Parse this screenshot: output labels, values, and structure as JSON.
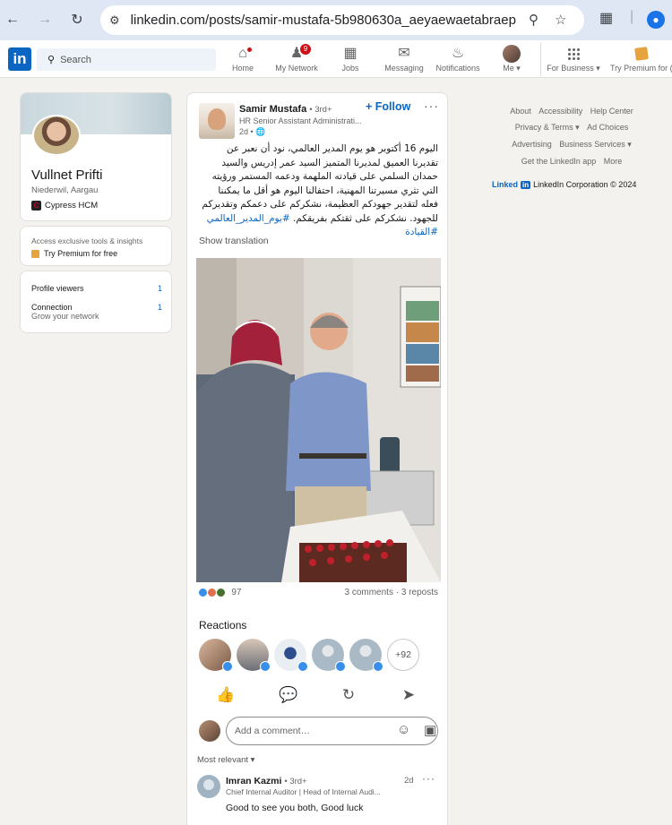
{
  "browser": {
    "url": "linkedin.com/posts/samir-mustafa-5b980630a_aeyaewaetabraepae...",
    "back_icon": "arrow-left",
    "forward_icon": "arrow-right",
    "reload_icon": "reload",
    "profile_initial": "•"
  },
  "header": {
    "search_placeholder": "Search",
    "nav": [
      {
        "label": "Home",
        "icon": "home-icon",
        "badge": ""
      },
      {
        "label": "My Network",
        "icon": "network-icon",
        "badge": "9"
      },
      {
        "label": "Jobs",
        "icon": "briefcase-icon",
        "badge": ""
      },
      {
        "label": "Messaging",
        "icon": "message-icon",
        "badge": ""
      },
      {
        "label": "Notifications",
        "icon": "bell-icon",
        "badge": ""
      },
      {
        "label": "Me",
        "icon": "avatar",
        "badge": ""
      },
      {
        "label": "For Business",
        "icon": "grid-icon",
        "badge": ""
      },
      {
        "label": "Try Premium for (",
        "icon": "premium-icon",
        "badge": ""
      }
    ]
  },
  "profile": {
    "name": "Vullnet Prifti",
    "location": "Niederwil, Aargau",
    "company": "Cypress HCM"
  },
  "premium": {
    "text": "Access exclusive tools & insights",
    "cta": "Try Premium for free"
  },
  "stats": {
    "profile_viewers_label": "Profile viewers",
    "profile_viewers_value": "1",
    "connection_label": "Connection",
    "connection_value": "1",
    "connection_sub": "Grow your network"
  },
  "footer": {
    "row1": [
      "About",
      "Accessibility",
      "Help Center"
    ],
    "row2": [
      "Privacy & Terms ▾",
      "Ad Choices"
    ],
    "row3": [
      "Advertising",
      "Business Services ▾"
    ],
    "row4": [
      "Get the LinkedIn app",
      "More"
    ],
    "brand_word": "Linked",
    "brand_box": "in",
    "copyright": "LinkedIn Corporation © 2024"
  },
  "post": {
    "author": "Samir Mustafa",
    "degree": "• 3rd+",
    "title": "HR Senior Assistant Administrati...",
    "time": "2d • 🌐",
    "follow": "+ Follow",
    "more": "···",
    "text_main": "اليوم 16 أكتوبر هو يوم المدير العالمي، نود أن نعبر عن تقديرنا العميق لمديرنا المتميز السيد عمر إدريس والسيد حمدان السلمي على قيادته الملهمة ودعمه المستمر ورؤيته التي تثري مسيرتنا المهنية، احتفالنا اليوم هو أقل ما يمكننا فعله لتقدير جهودكم العظيمة، نشكركم على دعمكم وتقديركم للجهود. نشكركم على ثقتكم بفريقكم.",
    "hashtags": "#يوم_المدير_العالمي #القيادة",
    "show_translation": "Show translation",
    "reaction_count": "97",
    "comments": "3 comments",
    "reposts": "3 reposts",
    "reactions_title": "Reactions",
    "reactors_more": "+92",
    "comment_placeholder": "Add a comment…",
    "sort_label": "Most relevant ▾"
  },
  "comment": {
    "author": "Imran Kazmi",
    "degree": "• 3rd+",
    "title": "Chief Internal Auditor | Head of Internal Audi...",
    "time": "2d",
    "more": "···",
    "text": "Good to see you both, Good luck"
  },
  "colors": {
    "brand": "#0a66c2",
    "badge": "#cc1016",
    "like": "#378fe9"
  }
}
